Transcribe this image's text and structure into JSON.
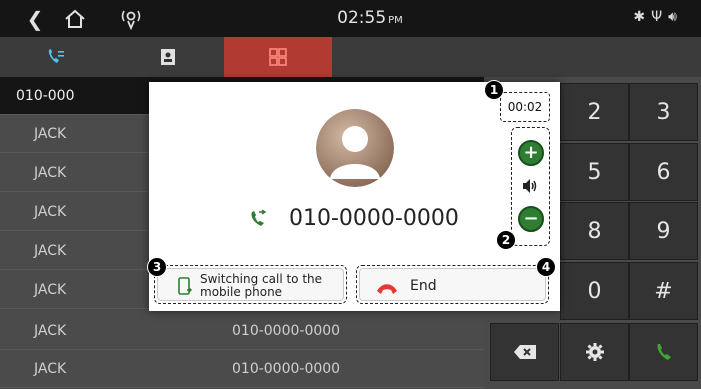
{
  "status_bar": {
    "time": "02:55",
    "ampm": "PM"
  },
  "tabs": [
    {
      "name": "recent-calls",
      "icon": "call-log-icon"
    },
    {
      "name": "contacts",
      "icon": "contacts-book-icon"
    },
    {
      "name": "keypad",
      "icon": "dialpad-icon",
      "active": true
    }
  ],
  "call_list": [
    {
      "name": "010-000",
      "number": "",
      "selected": true
    },
    {
      "name": "JACK",
      "number": ""
    },
    {
      "name": "JACK",
      "number": ""
    },
    {
      "name": "JACK",
      "number": ""
    },
    {
      "name": "JACK",
      "number": ""
    },
    {
      "name": "JACK",
      "number": ""
    },
    {
      "name": "JACK",
      "number": "010-0000-0000"
    },
    {
      "name": "JACK",
      "number": "010-0000-0000"
    }
  ],
  "keypad": {
    "keys": [
      "2",
      "3",
      "5",
      "6",
      "8",
      "9",
      "0",
      "#"
    ],
    "bottom_icons": [
      "backspace-icon",
      "settings-icon",
      "call-icon"
    ]
  },
  "popup": {
    "timer": "00:02",
    "caller_number": "010-0000-0000",
    "switch_label": "Switching call to the mobile phone",
    "end_label": "End",
    "badges": [
      "1",
      "2",
      "3",
      "4"
    ]
  },
  "colors": {
    "active_tab": "#b13a32",
    "green": "#2e7d32",
    "end_red": "#e53935",
    "call_green": "#3fa535"
  }
}
